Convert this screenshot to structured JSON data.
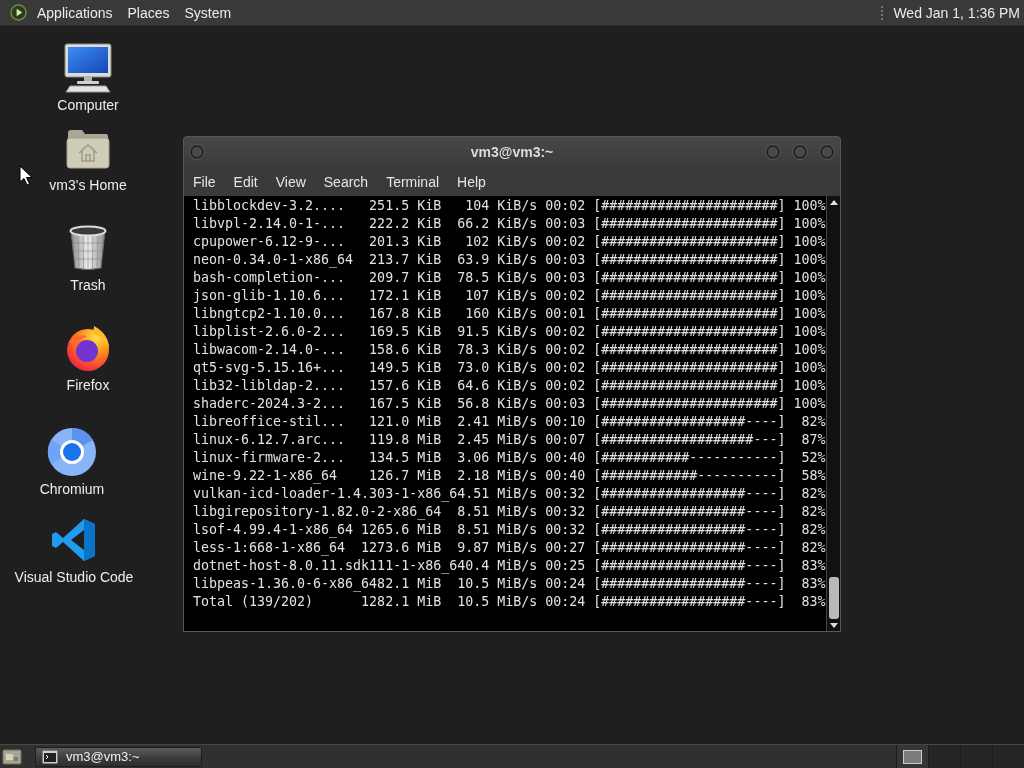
{
  "top_panel": {
    "menus": [
      "Applications",
      "Places",
      "System"
    ],
    "clock": "Wed Jan 1, 1:36 PM"
  },
  "desktop_icons": [
    {
      "kind": "computer",
      "label": "Computer"
    },
    {
      "kind": "home",
      "label": "vm3's Home"
    },
    {
      "kind": "trash",
      "label": "Trash"
    },
    {
      "kind": "firefox",
      "label": "Firefox"
    },
    {
      "kind": "chromium",
      "label": "Chromium"
    },
    {
      "kind": "vscode",
      "label": "Visual Studio Code"
    }
  ],
  "terminal_window": {
    "title": "vm3@vm3:~",
    "menu": [
      "File",
      "Edit",
      "View",
      "Search",
      "Terminal",
      "Help"
    ],
    "lines": [
      "libblockdev-3.2....   251.5 KiB   104 KiB/s 00:02 [######################] 100%",
      "libvpl-2.14.0-1-...   222.2 KiB  66.2 KiB/s 00:03 [######################] 100%",
      "cpupower-6.12-9-...   201.3 KiB   102 KiB/s 00:02 [######################] 100%",
      "neon-0.34.0-1-x86_64  213.7 KiB  63.9 KiB/s 00:03 [######################] 100%",
      "bash-completion-...   209.7 KiB  78.5 KiB/s 00:03 [######################] 100%",
      "json-glib-1.10.6...   172.1 KiB   107 KiB/s 00:02 [######################] 100%",
      "libngtcp2-1.10.0...   167.8 KiB   160 KiB/s 00:01 [######################] 100%",
      "libplist-2.6.0-2...   169.5 KiB  91.5 KiB/s 00:02 [######################] 100%",
      "libwacom-2.14.0-...   158.6 KiB  78.3 KiB/s 00:02 [######################] 100%",
      "qt5-svg-5.15.16+...   149.5 KiB  73.0 KiB/s 00:02 [######################] 100%",
      "lib32-libldap-2....   157.6 KiB  64.6 KiB/s 00:02 [######################] 100%",
      "shaderc-2024.3-2...   167.5 KiB  56.8 KiB/s 00:03 [######################] 100%",
      "libreoffice-stil...   121.0 MiB  2.41 MiB/s 00:10 [##################----]  82%",
      "linux-6.12.7.arc...   119.8 MiB  2.45 MiB/s 00:07 [###################---]  87%",
      "linux-firmware-2...   134.5 MiB  3.06 MiB/s 00:40 [###########-----------]  52%",
      "wine-9.22-1-x86_64    126.7 MiB  2.18 MiB/s 00:40 [############----------]  58%",
      "vulkan-icd-loader-1.4.303-1-x86_64.51 MiB/s 00:32 [##################----]  82%",
      "libgirepository-1.82.0-2-x86_64  8.51 MiB/s 00:32 [##################----]  82%",
      "lsof-4.99.4-1-x86_64 1265.6 MiB  8.51 MiB/s 00:32 [##################----]  82%",
      "less-1:668-1-x86_64  1273.6 MiB  9.87 MiB/s 00:27 [##################----]  82%",
      "dotnet-host-8.0.11.sdk111-1-x86_640.4 MiB/s 00:25 [##################----]  83%",
      "libpeas-1.36.0-6-x86_6482.1 MiB  10.5 MiB/s 00:24 [##################----]  83%",
      "Total (139/202)      1282.1 MiB  10.5 MiB/s 00:24 [##################----]  83%"
    ]
  },
  "bottom_panel": {
    "tasks": [
      {
        "label": "vm3@vm3:~",
        "selected": true
      }
    ],
    "workspaces": [
      {
        "selected": true
      },
      {
        "selected": false
      },
      {
        "selected": false
      },
      {
        "selected": false
      }
    ]
  }
}
